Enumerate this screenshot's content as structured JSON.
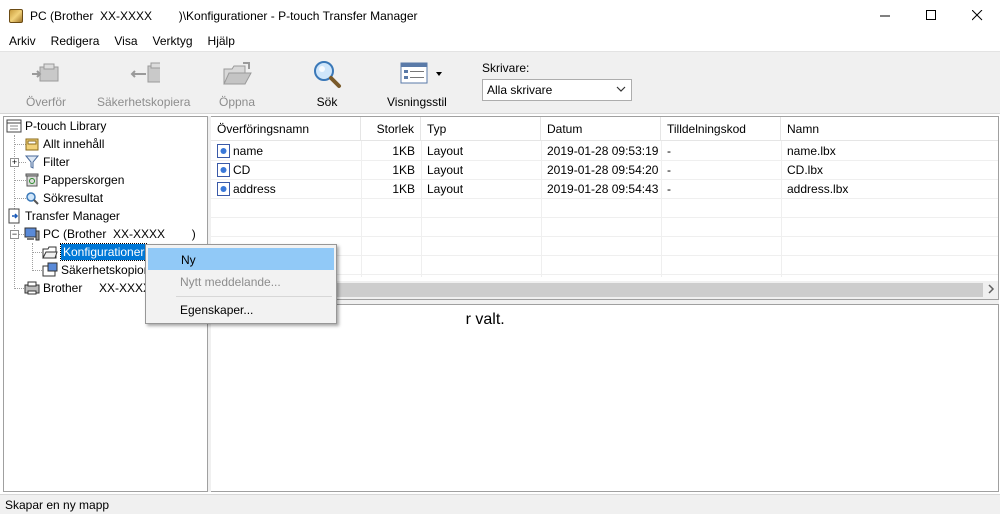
{
  "window": {
    "title": "PC (Brother  XX-XXXX        )\\Konfigurationer - P-touch Transfer Manager",
    "title_pc": "PC (Brother  XX-XXXX        )",
    "title_rest": "\\Konfigurationer - P-touch Transfer Manager",
    "minimize": "—",
    "maximize": "☐",
    "close": "✕"
  },
  "menu": [
    "Arkiv",
    "Redigera",
    "Visa",
    "Verktyg",
    "Hjälp"
  ],
  "toolbar": {
    "transfer": "Överför",
    "backup": "Säkerhetskopiera",
    "open": "Öppna",
    "search": "Sök",
    "view_style": "Visningsstil",
    "printer_label": "Skrivare:",
    "printer_value": "Alla skrivare"
  },
  "tree": {
    "library": "P-touch Library",
    "all_content": "Allt innehåll",
    "filter": "Filter",
    "trash": "Papperskorgen",
    "search_results": "Sökresultat",
    "transfer_manager": "Transfer Manager",
    "pc": "PC (Brother  XX-XXXX        )",
    "configurations": "Konfigurationer",
    "backups": "Säkerhetskopior",
    "brother": "Brother     XX-XXXX"
  },
  "list": {
    "columns": [
      "Överföringsnamn",
      "Storlek",
      "Typ",
      "Datum",
      "Tilldelningskod",
      "Namn"
    ],
    "rows": [
      {
        "name": "name",
        "size": "1KB",
        "type": "Layout",
        "date": "2019-01-28 09:53:19",
        "code": "-",
        "file": "name.lbx"
      },
      {
        "name": "CD",
        "size": "1KB",
        "type": "Layout",
        "date": "2019-01-28 09:54:20",
        "code": "-",
        "file": "CD.lbx"
      },
      {
        "name": "address",
        "size": "1KB",
        "type": "Layout",
        "date": "2019-01-28 09:54:43",
        "code": "-",
        "file": "address.lbx"
      }
    ]
  },
  "preview": {
    "message_tail": "r valt."
  },
  "context_menu": {
    "new": "Ny",
    "new_message": "Nytt meddelande...",
    "properties": "Egenskaper..."
  },
  "status": "Skapar en ny mapp"
}
